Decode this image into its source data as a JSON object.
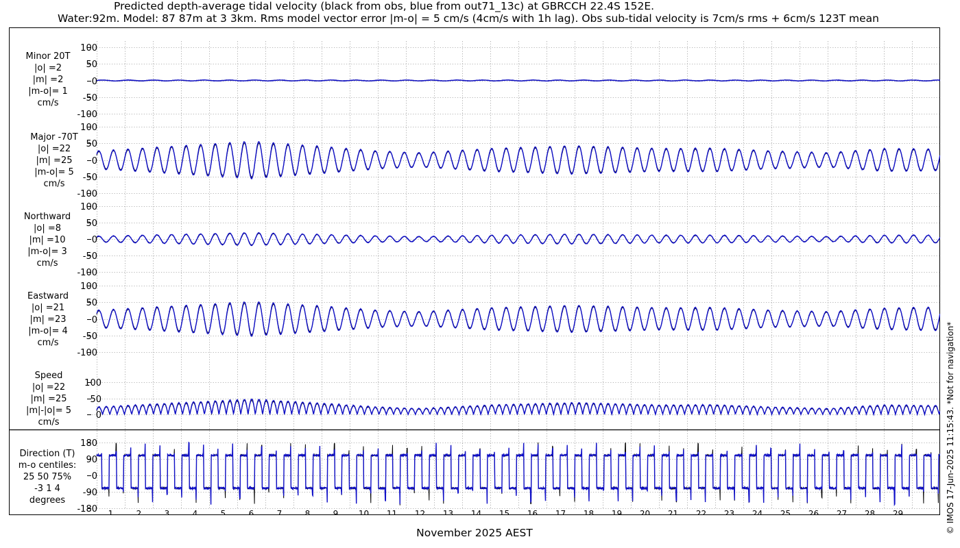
{
  "title": {
    "line1": "Predicted depth-average tidal velocity (black from obs, blue from out71_13c) at GBRCCH 22.4S 152E.",
    "line2": "Water:92m. Model: 87 87m at 3 3km. Rms model vector error |m-o| = 5 cm/s (4cm/s with 1h lag). Obs sub-tidal velocity is 7cm/s rms + 6cm/s 123T mean"
  },
  "xlabel": "November 2025 AEST",
  "copyright": "© IMOS 17-Jun-2025 11:15:43. *Not for navigation*",
  "colors": {
    "obs": "#000000",
    "model": "#1010c8",
    "grid": "#9a9a9a"
  },
  "panel_labels": [
    [
      "Minor 20T",
      "|o| =2",
      "|m| =2",
      "|m-o|= 1",
      "cm/s"
    ],
    [
      "Major -70T",
      "|o| =22",
      "|m| =25",
      "|m-o|= 5",
      "cm/s"
    ],
    [
      "Northward",
      "|o| =8",
      "|m| =10",
      "|m-o|= 3",
      "cm/s"
    ],
    [
      "Eastward",
      "|o| =21",
      "|m| =23",
      "|m-o|= 4",
      "cm/s"
    ],
    [
      "Speed",
      "|o| =22",
      "|m| =25",
      "|m|-|o|= 5",
      "cm/s"
    ],
    [
      "Direction (T)",
      "m-o centiles:",
      "25  50  75%",
      "-3   1   4",
      "degrees"
    ]
  ],
  "chart_data": [
    {
      "type": "line",
      "title": "Minor 20T",
      "ylabel": "cm/s",
      "ylim": [
        -100,
        100
      ],
      "yticks": [
        "100",
        "50",
        "0",
        "-50",
        "-100"
      ],
      "xlim": [
        0,
        30
      ],
      "grid": true,
      "series": [
        {
          "role": "obs",
          "amplitude": 2
        },
        {
          "role": "model",
          "amplitude": 2
        }
      ],
      "stats": {
        "obs_rms": 2,
        "model_rms": 2,
        "error_rms": 1
      }
    },
    {
      "type": "line",
      "title": "Major -70T",
      "ylabel": "cm/s",
      "ylim": [
        -100,
        100
      ],
      "yticks": [
        "100",
        "50",
        "0",
        "-50",
        "-100"
      ],
      "xlim": [
        0,
        30
      ],
      "grid": true,
      "series": [
        {
          "role": "obs",
          "amplitude": 30
        },
        {
          "role": "model",
          "amplitude": 33
        }
      ],
      "peak_amplitudes": [
        [
          0,
          25
        ],
        [
          5.5,
          52
        ],
        [
          8,
          38
        ],
        [
          10,
          25
        ],
        [
          11.5,
          20
        ],
        [
          14,
          32
        ],
        [
          17,
          40
        ],
        [
          20,
          32
        ],
        [
          22,
          33
        ],
        [
          24,
          25
        ],
        [
          26,
          20
        ],
        [
          28,
          32
        ],
        [
          30,
          30
        ]
      ],
      "stats": {
        "obs_rms": 22,
        "model_rms": 25,
        "error_rms": 5
      }
    },
    {
      "type": "line",
      "title": "Northward",
      "ylabel": "cm/s",
      "ylim": [
        -100,
        100
      ],
      "yticks": [
        "100",
        "50",
        "0",
        "-50",
        "-100"
      ],
      "xlim": [
        0,
        30
      ],
      "grid": true,
      "series": [
        {
          "role": "obs",
          "amplitude": 11
        },
        {
          "role": "model",
          "amplitude": 13
        }
      ],
      "peak_amplitudes": [
        [
          0,
          8
        ],
        [
          5.5,
          18
        ],
        [
          8,
          13
        ],
        [
          10,
          9
        ],
        [
          11.5,
          7
        ],
        [
          14,
          11
        ],
        [
          17,
          14
        ],
        [
          20,
          11
        ],
        [
          22,
          11
        ],
        [
          24,
          9
        ],
        [
          26,
          7
        ],
        [
          28,
          11
        ],
        [
          30,
          11
        ]
      ],
      "stats": {
        "obs_rms": 8,
        "model_rms": 10,
        "error_rms": 3
      }
    },
    {
      "type": "line",
      "title": "Eastward",
      "ylabel": "cm/s",
      "ylim": [
        -100,
        100
      ],
      "yticks": [
        "100",
        "50",
        "0",
        "-50",
        "-100"
      ],
      "xlim": [
        0,
        30
      ],
      "grid": true,
      "series": [
        {
          "role": "obs",
          "amplitude": 29
        },
        {
          "role": "model",
          "amplitude": 31
        }
      ],
      "peak_amplitudes": [
        [
          0,
          24
        ],
        [
          5.5,
          48
        ],
        [
          8,
          36
        ],
        [
          10,
          24
        ],
        [
          11.5,
          20
        ],
        [
          14,
          31
        ],
        [
          17,
          38
        ],
        [
          20,
          31
        ],
        [
          22,
          32
        ],
        [
          24,
          24
        ],
        [
          26,
          20
        ],
        [
          28,
          30
        ],
        [
          30,
          33
        ]
      ],
      "stats": {
        "obs_rms": 21,
        "model_rms": 23,
        "error_rms": 4
      }
    },
    {
      "type": "line",
      "title": "Speed",
      "ylabel": "cm/s",
      "ylim": [
        0,
        100
      ],
      "yticks": [
        "100",
        "50",
        "0"
      ],
      "xlim": [
        0,
        30
      ],
      "grid": true,
      "series": [
        {
          "role": "obs",
          "amplitude": 22
        },
        {
          "role": "model",
          "amplitude": 25
        }
      ],
      "stats": {
        "obs_rms": 22,
        "model_rms": 25,
        "speed_diff": 5
      }
    },
    {
      "type": "line",
      "title": "Direction (T)",
      "ylabel": "degrees",
      "ylim": [
        -180,
        180
      ],
      "yticks": [
        "180",
        "90",
        "0",
        "-90",
        "-180"
      ],
      "xlim": [
        0,
        30
      ],
      "grid": true,
      "series": [
        {
          "role": "obs",
          "levels": [
            110,
            -70
          ]
        },
        {
          "role": "model",
          "levels": [
            110,
            -70
          ]
        }
      ],
      "centiles": {
        "25": -3,
        "50": 1,
        "75": 4
      }
    }
  ],
  "xticks": [
    "1",
    "2",
    "3",
    "4",
    "5",
    "6",
    "7",
    "8",
    "9",
    "10",
    "11",
    "12",
    "13",
    "14",
    "15",
    "16",
    "17",
    "18",
    "19",
    "20",
    "21",
    "22",
    "23",
    "24",
    "25",
    "26",
    "27",
    "28",
    "29"
  ]
}
